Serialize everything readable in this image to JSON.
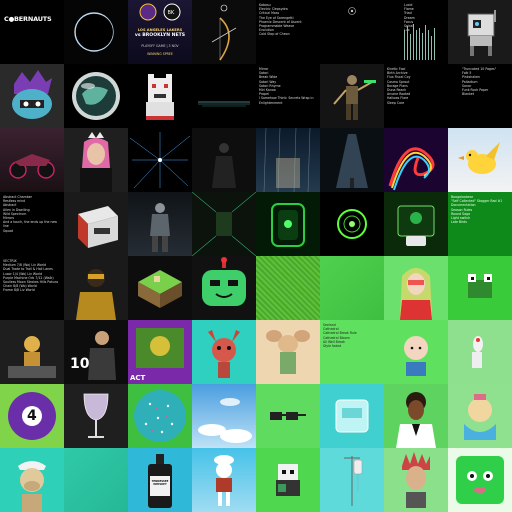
{
  "brand": {
    "logo_text": "C●BERNAUTS"
  },
  "poster": {
    "line1": "LOS ANGELES LAKERS",
    "line2": "vs BROOKLYN NETS",
    "line3": "PLAYOFF GAME | 3 NOV",
    "line4": "WINNING SPREE"
  },
  "text_tiles": {
    "r0c4": "Kabosu\nElectric Clepsydra\nCritical Mass\nThe Eye of Sarengetti\nPhoenix Descent of Ascent\nProgrammable Weave\nEvolution\nCold Stop of Cheon",
    "r0c6": "Lucid\nFlame\nTriad\nDream\nFocus\nSpiral\nLux",
    "r1c4": "Mirror\nSatori\nBreak Wide\nSatori Way\nSatori Rhyme\nMiri Kanoa\nPropel\nI Somehow Think: Secrets Wrap in Enlightenment",
    "r1c6": "Kinetic Fool\nBirth Archive\nFlux Fiscal Coy\nCosmo Sprout\nBorage Plans\nDuna Reach\nArcane Rooted\nHallows Flare\nSleep Core",
    "r1c7": "\"Truncated 10 Pages\"\nFolk 5\nPinkshaken\nPalladium\nSonar\nFunk Rock Paper\nBlanket",
    "r3c0": "Abstract Chamber\nRestless mind\nAbstract\nAlien in Dwelling\nWild Spectrum\nMirrors\nAnd a touch, the ends up the new line\nSquad",
    "r3c7": "Boogaloobear\n\"Self Collected\" Stagger Bad #1\nDocumentation\nSeason Rules\nRound Saga\nLight switch\nLate Birds",
    "r4c0": "VECTRIX\nMedium 7/8 (Wo) Liv World\nDual Trade to Trail & Hall Lanes\nLuxor 1/4 (Wo) Liv World\nPurple Machine Orb 7/12 (Walk)\nSoulless Moon Strokes Hills Pakura\nChain 8/8 (Wo) World\nFrame 8/8 Liv World",
    "r5c4": "Seeland\nCathedral\nCathedral Break Rule\nCathedral Bloom\nAll Well Break\nStyle faded"
  },
  "icons": {
    "r6c0": "billiard-ball-8-icon",
    "r6c1": "wine-glass-icon",
    "r6c2": "pixel-glitter-sphere-icon",
    "r7c2": "whiskey-bottle-icon",
    "r7c6": "iv-drip-icon"
  },
  "labels": {
    "ball_number": "4",
    "bottle_label": "TENNESSEE WHISKEY",
    "date_label": "10",
    "act_label": "ACT"
  },
  "colors": {
    "background": "#000000",
    "green_accent": "#3ecf3e",
    "aqua": "#2fd0c0",
    "purple": "#7a2aa8"
  }
}
